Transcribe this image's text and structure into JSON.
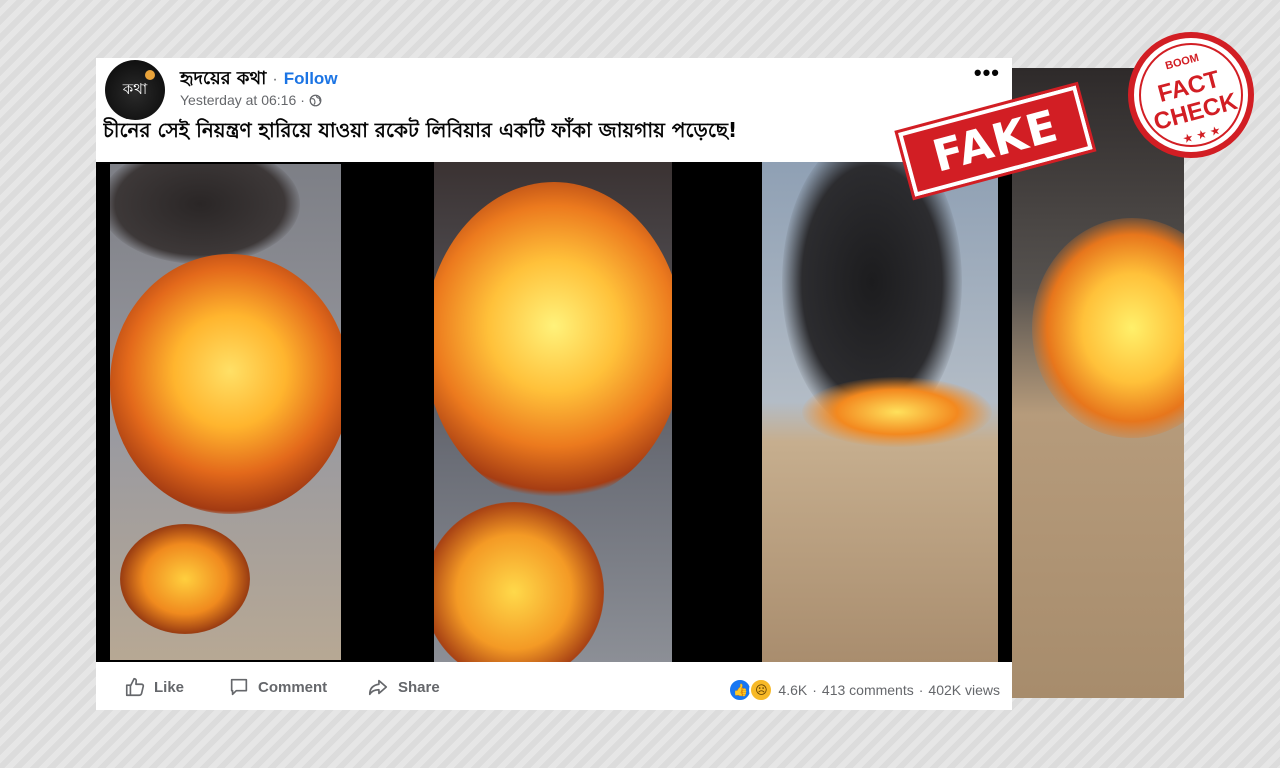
{
  "post": {
    "author": "হৃদয়ের কথা",
    "separator": "·",
    "follow_label": "Follow",
    "timestamp": "Yesterday at 06:16",
    "meta_separator": "·",
    "caption": "চীনের সেই নিয়ন্ত্রণ হারিয়ে যাওয়া রকেট লিবিয়ার একটি ফাঁকা জায়গায় পড়েছে!",
    "avatar_text": "কথা",
    "more_label": "•••"
  },
  "actions": {
    "like_label": "Like",
    "comment_label": "Comment",
    "share_label": "Share"
  },
  "stats": {
    "reaction_count": "4.6K",
    "sep1": "·",
    "comments": "413 comments",
    "sep2": "·",
    "views": "402K views"
  },
  "overlay": {
    "fake_label": "FAKE",
    "stamp_brand": "BOOM",
    "stamp_line1": "FACT",
    "stamp_line2": "CHECK"
  },
  "colors": {
    "accent": "#1b74e4",
    "fake_red": "#d21e24"
  },
  "icons": [
    "globe-icon",
    "like-icon",
    "comment-icon",
    "share-icon",
    "more-icon"
  ]
}
